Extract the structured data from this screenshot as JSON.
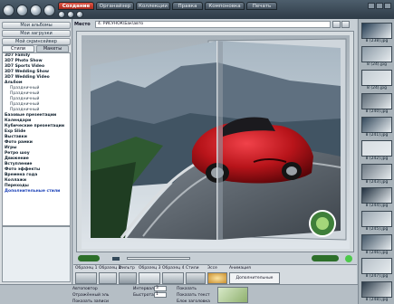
{
  "top_tabs": [
    "Создание",
    "Органайзер",
    "Коллекции",
    "Правка",
    "Компоновка",
    "Печать"
  ],
  "sidebar": {
    "buttons": [
      "Мои альбомы",
      "Мои загрузки",
      "Мой скринсейвер"
    ],
    "tabs": [
      "Стили",
      "Макеты"
    ],
    "tree": [
      {
        "label": "3D7 Family",
        "sub": false
      },
      {
        "label": "3D7 Photo Show",
        "sub": false
      },
      {
        "label": "3D7 Sports Video",
        "sub": false
      },
      {
        "label": "3D7 Wedding Show",
        "sub": false
      },
      {
        "label": "3D7 Wedding Video",
        "sub": false
      },
      {
        "label": "Альбом",
        "sub": false
      },
      {
        "label": "Праздничный",
        "sub": true
      },
      {
        "label": "Праздничный",
        "sub": true
      },
      {
        "label": "Праздничный",
        "sub": true
      },
      {
        "label": "Праздничный",
        "sub": true
      },
      {
        "label": "Праздничный",
        "sub": true
      },
      {
        "label": "Базовые презентации",
        "sub": false
      },
      {
        "label": "Календари",
        "sub": false
      },
      {
        "label": "Кубические презентации",
        "sub": false
      },
      {
        "label": "Exp Slide",
        "sub": false
      },
      {
        "label": "Выставки",
        "sub": false
      },
      {
        "label": "Фото рамки",
        "sub": false
      },
      {
        "label": "Игры",
        "sub": false
      },
      {
        "label": "Ретро шоу",
        "sub": false
      },
      {
        "label": "Движение",
        "sub": false
      },
      {
        "label": "Вступление",
        "sub": false
      },
      {
        "label": "Фото эффекты",
        "sub": false
      },
      {
        "label": "Времена года",
        "sub": false
      },
      {
        "label": "Коллажи",
        "sub": false
      },
      {
        "label": "Переходы",
        "sub": false
      },
      {
        "label": "Дополнительные стили",
        "sub": false,
        "last": true
      }
    ]
  },
  "main": {
    "path_label": "Место",
    "path_value": "4. РИСУНОК\\Бак\\авто",
    "options_button": "Дополнительные опции",
    "bottom_labels": [
      "Образец 1",
      "Образец 2",
      "Фильтр",
      "Образец 3",
      "Образец 4",
      "Стили",
      "Эссе",
      "Анимация"
    ],
    "checkboxes": [
      "Автоповтор",
      "Отражённый эль",
      "Показать записи",
      "Показать",
      "Показать текст",
      "Блок заголовка"
    ],
    "field_labels": [
      "Интервал",
      "Быстрота"
    ],
    "field_values": [
      "3",
      "1"
    ]
  },
  "filmstrip": {
    "captions": [
      "8 (238).jpg",
      "8 (24).jpg",
      "8 (24).jpg",
      "8 (240).jpg",
      "8 (241).jpg",
      "8 (242).jpg",
      "8 (243).jpg",
      "8 (244).jpg",
      "8 (245).jpg",
      "8 (246).jpg",
      "8 (247).jpg",
      "8 (248).jpg"
    ]
  },
  "colors": {
    "active_tab": "#c43a2c",
    "car_red": "#b8141a",
    "link_blue": "#1d43b8"
  },
  "icons": [
    "camera-icon",
    "film-icon",
    "globe-icon",
    "folder-icon",
    "printer-icon",
    "music-icon",
    "gear-icon"
  ]
}
